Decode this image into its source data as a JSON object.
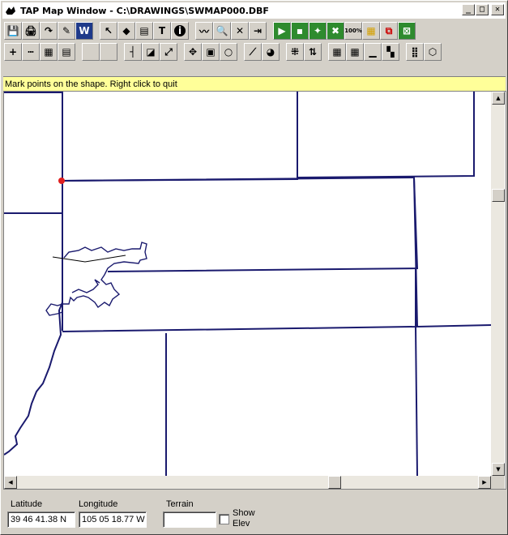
{
  "window": {
    "title": "TAP Map Window - C:\\DRAWINGS\\SWMAP000.DBF",
    "minimize": "_",
    "maximize": "□",
    "close": "✕"
  },
  "toolbar1": [
    {
      "name": "save-icon",
      "glyph": "💾"
    },
    {
      "name": "print-icon",
      "glyph": "🖨"
    },
    {
      "name": "redo-icon",
      "glyph": "↷"
    },
    {
      "name": "edit-document-icon",
      "glyph": "✎"
    },
    {
      "name": "word-icon",
      "glyph": "W"
    },
    {
      "name": "pointer-icon",
      "glyph": "↖"
    },
    {
      "name": "select-area-icon",
      "glyph": "◆"
    },
    {
      "name": "properties-icon",
      "glyph": "▤"
    },
    {
      "name": "text-tool-icon",
      "glyph": "T"
    },
    {
      "name": "info-icon",
      "glyph": "i"
    },
    {
      "name": "measure-route-icon",
      "glyph": "〰"
    },
    {
      "name": "search-icon",
      "glyph": "🔍"
    },
    {
      "name": "delete-icon",
      "glyph": "✕"
    },
    {
      "name": "exit-icon",
      "glyph": "⇥"
    },
    {
      "name": "green-tool-1-icon",
      "glyph": "▶"
    },
    {
      "name": "green-tool-2-icon",
      "glyph": "▪"
    },
    {
      "name": "green-tool-3-icon",
      "glyph": "✦"
    },
    {
      "name": "green-tool-4-icon",
      "glyph": "✖"
    },
    {
      "name": "zoom-100-icon",
      "glyph": "100%"
    },
    {
      "name": "yellow-tool-icon",
      "glyph": "▦"
    },
    {
      "name": "red-tool-icon",
      "glyph": "⧉"
    },
    {
      "name": "green-tool-5-icon",
      "glyph": "⊠"
    }
  ],
  "toolbar2": [
    {
      "name": "add-icon",
      "glyph": "+"
    },
    {
      "name": "ruler-icon",
      "glyph": "┅"
    },
    {
      "name": "grid-icon",
      "glyph": "▦"
    },
    {
      "name": "notes-icon",
      "glyph": "▤"
    },
    {
      "name": "blank-1-icon",
      "glyph": ""
    },
    {
      "name": "blank-2-icon",
      "glyph": ""
    },
    {
      "name": "corner-icon",
      "glyph": "┤"
    },
    {
      "name": "edit-shape-icon",
      "glyph": "◪"
    },
    {
      "name": "resize-icon",
      "glyph": "⤢"
    },
    {
      "name": "pan-icon",
      "glyph": "✥"
    },
    {
      "name": "layers-icon",
      "glyph": "▣"
    },
    {
      "name": "lasso-icon",
      "glyph": "○"
    },
    {
      "name": "profile-icon",
      "glyph": "⟋"
    },
    {
      "name": "pie-chart-icon",
      "glyph": "◕"
    },
    {
      "name": "scatter-icon",
      "glyph": "⁜"
    },
    {
      "name": "arrows-icon",
      "glyph": "⇅"
    },
    {
      "name": "grid-color-1-icon",
      "glyph": "▦"
    },
    {
      "name": "grid-color-2-icon",
      "glyph": "▦"
    },
    {
      "name": "histogram-icon",
      "glyph": "▁"
    },
    {
      "name": "matrix-icon",
      "glyph": "▚"
    },
    {
      "name": "dots-grid-icon",
      "glyph": "⣿"
    },
    {
      "name": "polygon-icon",
      "glyph": "⬡"
    }
  ],
  "status": {
    "message": "Mark points on the shape. Right click to quit"
  },
  "bottom": {
    "latitude_label": "Latitude",
    "latitude_value": "39 46 41.38 N",
    "longitude_label": "Longitude",
    "longitude_value": "105 05 18.77 W",
    "terrain_label": "Terrain",
    "terrain_value": "",
    "show_elev_label_1": "Show",
    "show_elev_label_2": "Elev",
    "show_elev_checked": false
  },
  "colors": {
    "status_bg": "#ffff99",
    "boundary_line": "#1a1a6e",
    "marker": "#e02020"
  }
}
